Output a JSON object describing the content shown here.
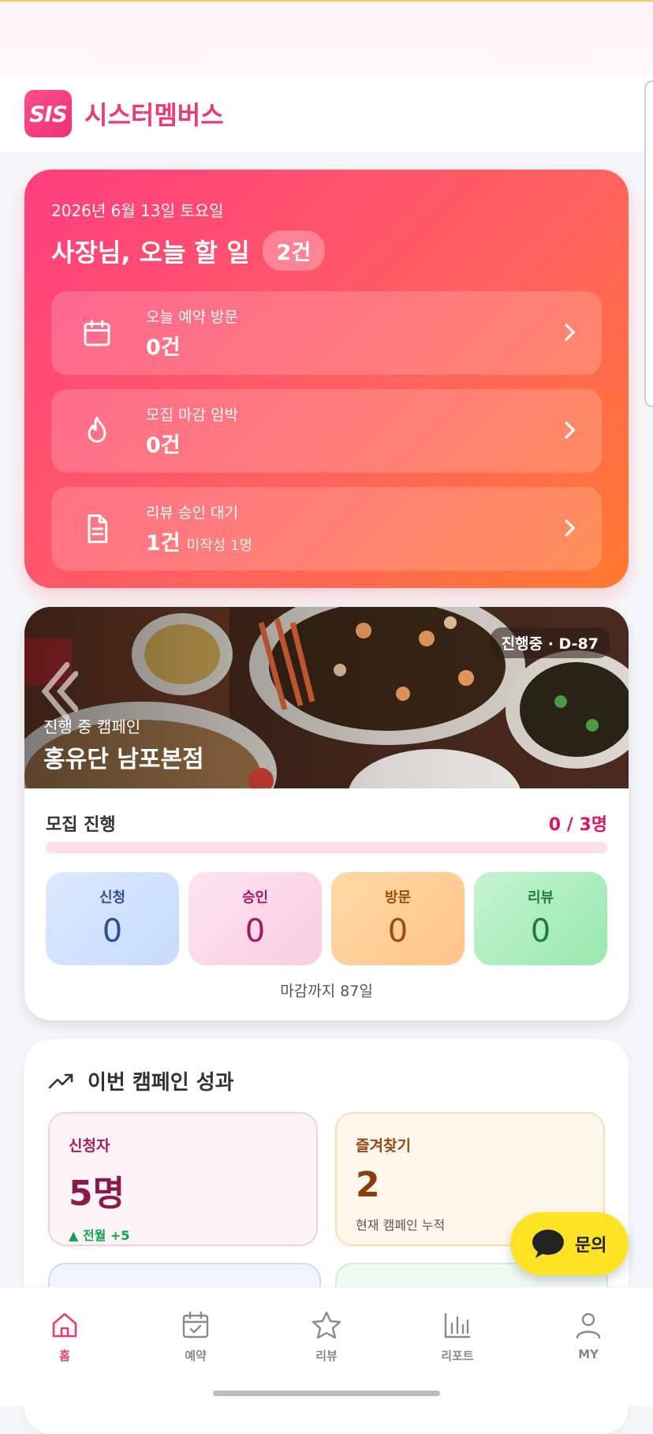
{
  "app": {
    "logo_text": "SIS",
    "name": "시스터멤버스"
  },
  "today": {
    "date": "2026년 6월 13일 토요일",
    "title": "사장님, 오늘 할 일",
    "count": "2건",
    "tasks": [
      {
        "label": "오늘 예약 방문",
        "value": "0건",
        "sub": "",
        "icon": "calendar-icon"
      },
      {
        "label": "모집 마감 임박",
        "value": "0건",
        "sub": "",
        "icon": "flame-icon"
      },
      {
        "label": "리뷰 승인 대기",
        "value": "1건",
        "sub": "미작성 1명",
        "icon": "document-icon"
      }
    ]
  },
  "campaign": {
    "badge": "진행중 · D-87",
    "subtitle": "진행 중 캠페인",
    "name": "홍유단 남포본점",
    "recruit_label": "모집 진행",
    "recruit_value": "0 / 3명",
    "progress": 0,
    "stats": [
      {
        "label": "신청",
        "value": "0"
      },
      {
        "label": "승인",
        "value": "0"
      },
      {
        "label": "방문",
        "value": "0"
      },
      {
        "label": "리뷰",
        "value": "0"
      }
    ],
    "deadline": "마감까지 87일"
  },
  "performance": {
    "title": "이번 캠페인 성과",
    "metrics": [
      {
        "label": "신청자",
        "value": "5명",
        "sub": "▲ 전월 +5"
      },
      {
        "label": "즐겨찾기",
        "value": "2",
        "sub": "현재 캠페인 누적"
      }
    ]
  },
  "fab": {
    "label": "문의"
  },
  "nav": {
    "items": [
      {
        "label": "홈",
        "icon": "home-icon",
        "active": true
      },
      {
        "label": "예약",
        "icon": "calendar-check-icon",
        "active": false
      },
      {
        "label": "리뷰",
        "icon": "star-icon",
        "active": false
      },
      {
        "label": "리포트",
        "icon": "bar-chart-icon",
        "active": false
      },
      {
        "label": "MY",
        "icon": "user-icon",
        "active": false
      }
    ]
  },
  "colors": {
    "brand": "#ec3a78",
    "today_gradient_start": "#ff3e7f",
    "today_gradient_end": "#ff7a2f",
    "fab": "#fde324"
  }
}
